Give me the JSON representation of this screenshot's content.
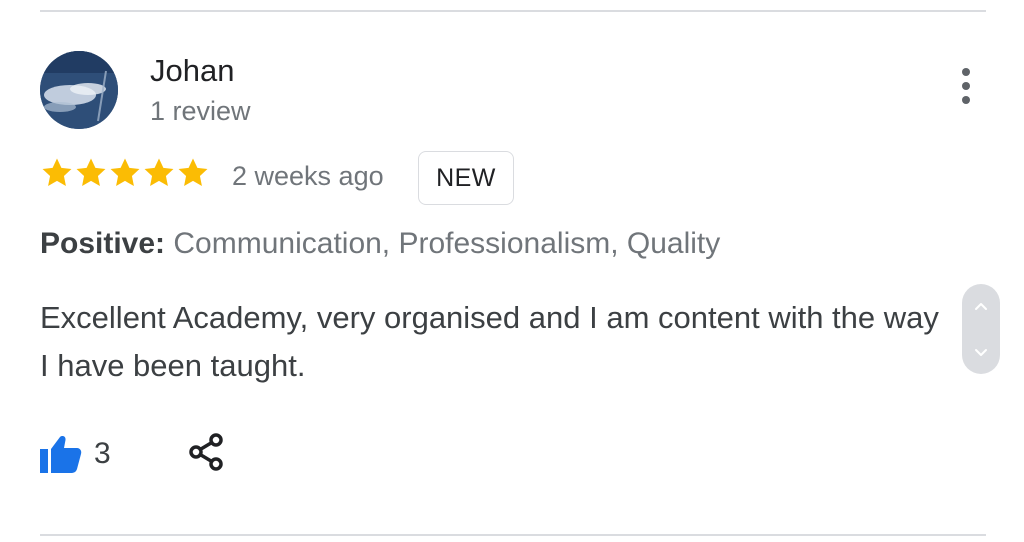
{
  "reviewer": {
    "name": "Johan",
    "review_count": "1 review",
    "avatar_icon": "avatar-photo"
  },
  "rating": {
    "stars": 5,
    "max_stars": 5,
    "star_color": "#fbbc04",
    "time_ago": "2 weeks ago",
    "badge": "NEW"
  },
  "attributes": {
    "label": "Positive:",
    "values": "Communication, Professionalism, Quality"
  },
  "review": {
    "text": "Excellent Academy, very organised and I am content with the way I have been taught."
  },
  "actions": {
    "like_count": "3",
    "like_icon": "thumbs-up-icon",
    "like_color": "#1a73e8",
    "share_icon": "share-icon",
    "menu_icon": "more-vert-icon"
  },
  "scroll_control": {
    "up_icon": "chevron-up-icon",
    "down_icon": "chevron-down-icon"
  }
}
